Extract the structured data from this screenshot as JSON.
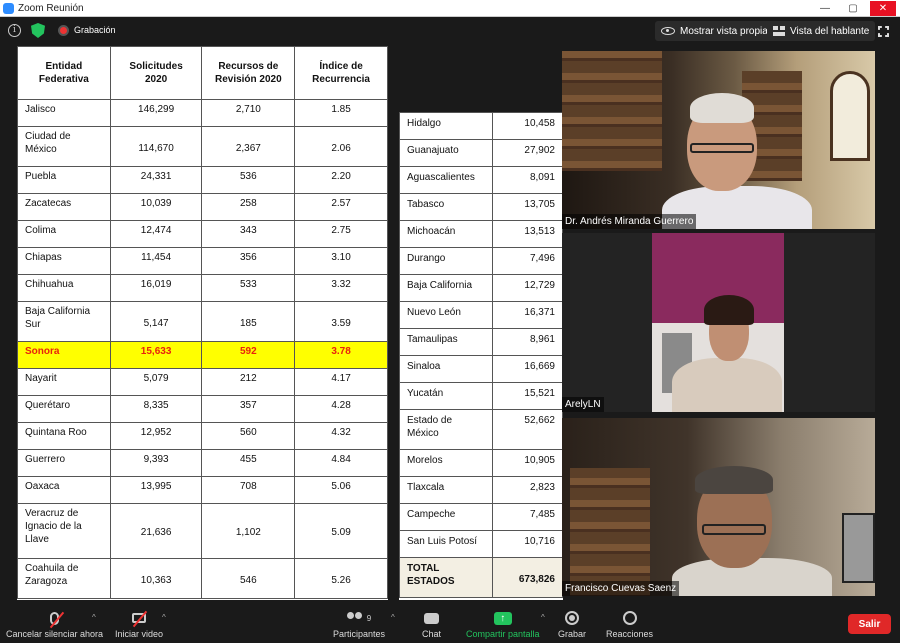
{
  "window": {
    "title": "Zoom Reunión"
  },
  "meeting": {
    "recording_label": "Grabación",
    "view_self_label": "Mostrar vista propia",
    "speaker_view_label": "Vista del hablante"
  },
  "table_left": {
    "headers": [
      "Entidad Federativa",
      "Solicitudes 2020",
      "Recursos de Revisión 2020",
      "Índice de Recurrencia"
    ],
    "rows": [
      {
        "state": "Jalisco",
        "solicitudes": "146,299",
        "recursos": "2,710",
        "indice": "1.85"
      },
      {
        "state": "Ciudad de México",
        "solicitudes": "114,670",
        "recursos": "2,367",
        "indice": "2.06"
      },
      {
        "state": "Puebla",
        "solicitudes": "24,331",
        "recursos": "536",
        "indice": "2.20"
      },
      {
        "state": "Zacatecas",
        "solicitudes": "10,039",
        "recursos": "258",
        "indice": "2.57"
      },
      {
        "state": "Colima",
        "solicitudes": "12,474",
        "recursos": "343",
        "indice": "2.75"
      },
      {
        "state": "Chiapas",
        "solicitudes": "11,454",
        "recursos": "356",
        "indice": "3.10"
      },
      {
        "state": "Chihuahua",
        "solicitudes": "16,019",
        "recursos": "533",
        "indice": "3.32"
      },
      {
        "state": "Baja California Sur",
        "solicitudes": "5,147",
        "recursos": "185",
        "indice": "3.59"
      },
      {
        "state": "Sonora",
        "solicitudes": "15,633",
        "recursos": "592",
        "indice": "3.78",
        "highlight": true
      },
      {
        "state": "Nayarit",
        "solicitudes": "5,079",
        "recursos": "212",
        "indice": "4.17"
      },
      {
        "state": "Querétaro",
        "solicitudes": "8,335",
        "recursos": "357",
        "indice": "4.28"
      },
      {
        "state": "Quintana Roo",
        "solicitudes": "12,952",
        "recursos": "560",
        "indice": "4.32"
      },
      {
        "state": "Guerrero",
        "solicitudes": "9,393",
        "recursos": "455",
        "indice": "4.84"
      },
      {
        "state": "Oaxaca",
        "solicitudes": "13,995",
        "recursos": "708",
        "indice": "5.06"
      },
      {
        "state": "Veracruz de Ignacio de la Llave",
        "solicitudes": "21,636",
        "recursos": "1,102",
        "indice": "5.09"
      },
      {
        "state": "Coahuila de Zaragoza",
        "solicitudes": "10,363",
        "recursos": "546",
        "indice": "5.26"
      }
    ]
  },
  "table_right": {
    "rows": [
      {
        "state": "Hidalgo",
        "solicitudes": "10,458"
      },
      {
        "state": "Guanajuato",
        "solicitudes": "27,902"
      },
      {
        "state": "Aguascalientes",
        "solicitudes": "8,091"
      },
      {
        "state": "Tabasco",
        "solicitudes": "13,705"
      },
      {
        "state": "Michoacán",
        "solicitudes": "13,513"
      },
      {
        "state": "Durango",
        "solicitudes": "7,496"
      },
      {
        "state": "Baja California",
        "solicitudes": "12,729"
      },
      {
        "state": "Nuevo León",
        "solicitudes": "16,371"
      },
      {
        "state": "Tamaulipas",
        "solicitudes": "8,961"
      },
      {
        "state": "Sinaloa",
        "solicitudes": "16,669"
      },
      {
        "state": "Yucatán",
        "solicitudes": "15,521"
      },
      {
        "state": "Estado de México",
        "solicitudes": "52,662"
      },
      {
        "state": "Morelos",
        "solicitudes": "10,905"
      },
      {
        "state": "Tlaxcala",
        "solicitudes": "2,823"
      },
      {
        "state": "Campeche",
        "solicitudes": "7,485"
      },
      {
        "state": "San Luis Potosí",
        "solicitudes": "10,716"
      }
    ],
    "total": {
      "label": "TOTAL ESTADOS",
      "solicitudes": "673,826"
    }
  },
  "participants": [
    {
      "name": "Dr. Andrés Miranda Guerrero"
    },
    {
      "name": "ArelyLN"
    },
    {
      "name": "Francisco Cuevas Saenz"
    }
  ],
  "toolbar": {
    "mute_label": "Cancelar silenciar ahora",
    "video_label": "Iniciar video",
    "participants_label": "Participantes",
    "participants_count": "9",
    "chat_label": "Chat",
    "share_label": "Compartir pantalla",
    "record_label": "Grabar",
    "reactions_label": "Reacciones",
    "leave_label": "Salir"
  }
}
